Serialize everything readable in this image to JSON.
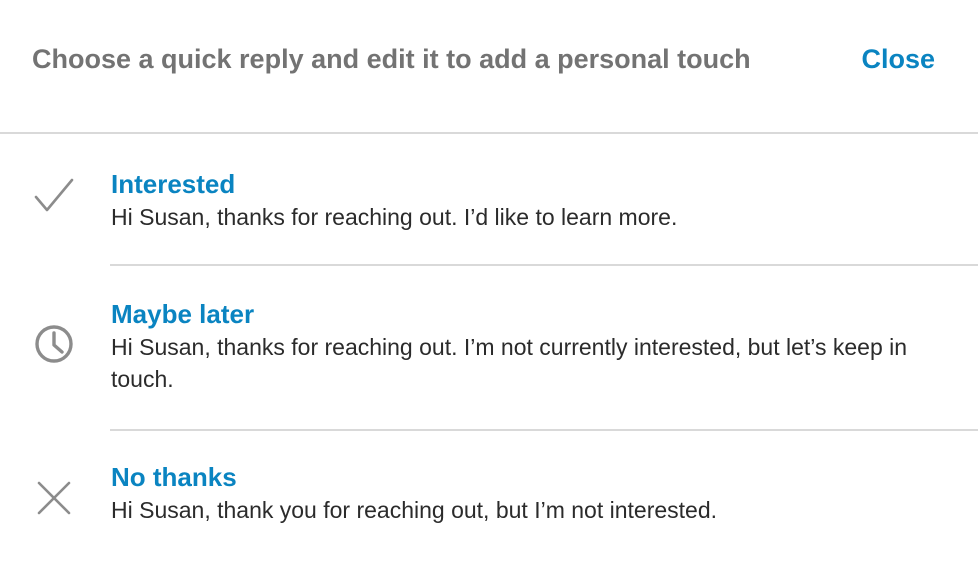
{
  "header": {
    "title": "Choose a quick reply and edit it to add a personal touch",
    "close_label": "Close"
  },
  "replies": [
    {
      "icon": "checkmark-icon",
      "title": "Interested",
      "message": "Hi Susan, thanks for reaching out. I’d like to learn more."
    },
    {
      "icon": "clock-icon",
      "title": "Maybe later",
      "message": "Hi Susan, thanks for reaching out. I’m not currently interested, but let’s keep in touch."
    },
    {
      "icon": "x-icon",
      "title": "No thanks",
      "message": "Hi Susan, thank you for reaching out, but I’m not interested."
    }
  ],
  "colors": {
    "accent": "#0a84c1",
    "header_text": "#737373",
    "body_text": "#2b2b2b",
    "icon": "#8c8c8c",
    "divider": "#d9d9d9"
  }
}
